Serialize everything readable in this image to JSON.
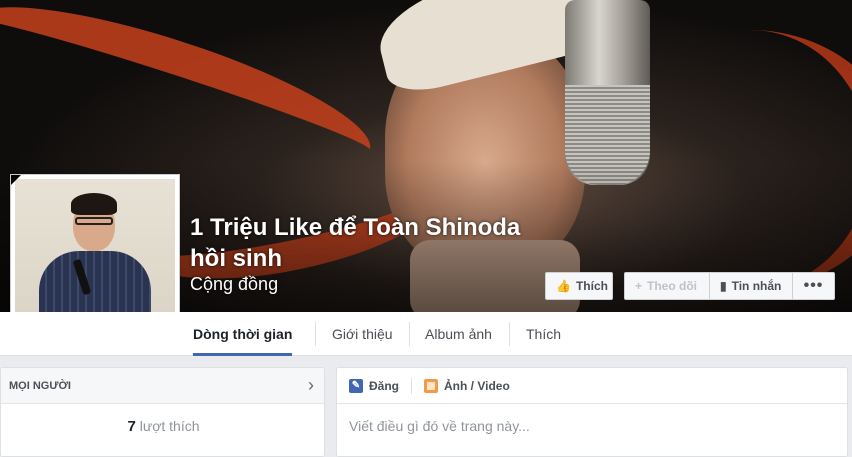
{
  "page": {
    "title": "1 Triệu Like để Toàn Shinoda hồi sinh",
    "category": "Cộng đồng"
  },
  "actions": {
    "like_label": "Thích",
    "follow_label": "Theo dõi",
    "message_label": "Tin nhắn",
    "more_label": "•••"
  },
  "tabs": [
    {
      "label": "Dòng thời gian",
      "active": true
    },
    {
      "label": "Giới thiệu"
    },
    {
      "label": "Album ảnh"
    },
    {
      "label": "Thích"
    }
  ],
  "people_card": {
    "header": "MỌI NGƯỜI",
    "likes_count": "7",
    "likes_suffix": "lượt thích"
  },
  "composer": {
    "tab_post": "Đăng",
    "tab_photo": "Ảnh / Video",
    "placeholder": "Viết điều gì đó về trang này..."
  },
  "icons": {
    "like": "thumbs-up-icon",
    "follow": "plus-icon",
    "message": "chat-bubble-icon",
    "more": "ellipsis-icon",
    "chevron": "chevron-right-icon",
    "post": "pencil-icon",
    "photo": "photo-icon"
  },
  "colors": {
    "accent": "#4267b2",
    "background": "#e9ebee"
  }
}
